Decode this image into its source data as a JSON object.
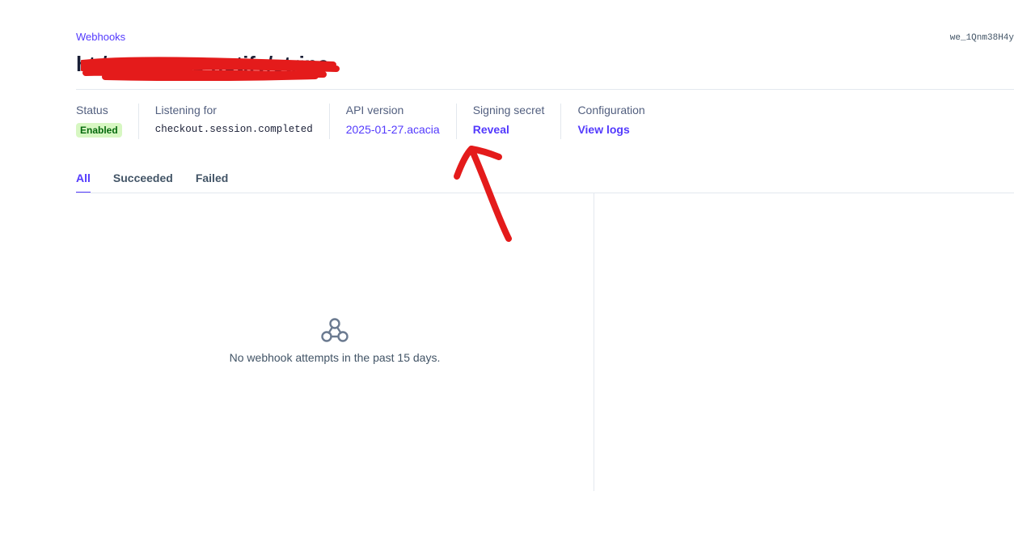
{
  "breadcrumb": "Webhooks",
  "endpoint_id": "we_1Qnm38H4y",
  "title": "ht             /payments-notify/stripe",
  "meta": {
    "status_label": "Status",
    "status_value": "Enabled",
    "listening_label": "Listening for",
    "listening_value": "checkout.session.completed",
    "api_label": "API version",
    "api_value": "2025-01-27.acacia",
    "secret_label": "Signing secret",
    "secret_value": "Reveal",
    "config_label": "Configuration",
    "config_value": "View logs"
  },
  "tabs": [
    "All",
    "Succeeded",
    "Failed"
  ],
  "empty": {
    "icon": "webhook-icon",
    "text": "No webhook attempts in the past 15 days."
  },
  "colors": {
    "accent": "#533afd",
    "badge_bg": "#d7f7c2",
    "badge_text": "#05690d",
    "annotation": "#e41b1b"
  }
}
